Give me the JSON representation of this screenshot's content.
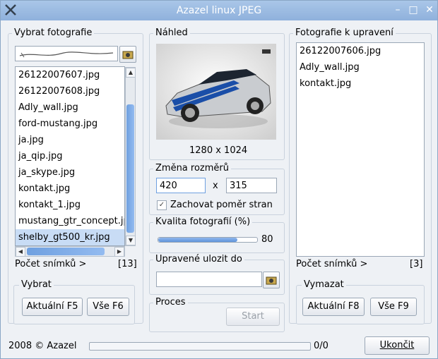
{
  "window": {
    "title": "Azazel linux JPEG"
  },
  "left": {
    "group_label": "Vybrat fotografie",
    "files": [
      "26122007607.jpg",
      "26122007608.jpg",
      "Adly_wall.jpg",
      "ford-mustang.jpg",
      "ja.jpg",
      "ja_qip.jpg",
      "ja_skype.jpg",
      "kontakt.jpg",
      "kontakt_1.jpg",
      "mustang_gtr_concept.jpg",
      "shelby_gt500_kr.jpg"
    ],
    "selected": "shelby_gt500_kr.jpg",
    "count_label": "Počet snímků >",
    "count_value": "[13]",
    "select_group_label": "Vybrat",
    "btn_current": "Aktuální F5",
    "btn_all": "Vše F6"
  },
  "center": {
    "preview_label": "Náhled",
    "dimensions": "1280 x 1024",
    "resize_label": "Změna rozměrů",
    "width_value": "420",
    "height_value": "315",
    "x_sep": "x",
    "keep_ratio_label": "Zachovat poměr stran",
    "keep_ratio_checked": true,
    "quality_label": "Kvalita fotografií (%)",
    "quality_value": "80",
    "save_to_label": "Upravené ulozit do",
    "save_to_value": "",
    "process_label": "Proces",
    "start_label": "Start"
  },
  "right": {
    "group_label": "Fotografie k upravení",
    "files": [
      "26122007606.jpg",
      "Adly_wall.jpg",
      "kontakt.jpg"
    ],
    "count_label": "Počet snímků >",
    "count_value": "[3]",
    "delete_group_label": "Vymazat",
    "btn_current": "Aktuální F8",
    "btn_all": "Vše F9"
  },
  "footer": {
    "copyright": "2008 © Azazel",
    "progress_text": "0/0",
    "progress_fraction": 0,
    "quit_label": "Ukončit"
  },
  "colors": {
    "titlebar": "#9bbce3",
    "selection": "#c8dcf5",
    "accent": "#6fa0e0"
  }
}
